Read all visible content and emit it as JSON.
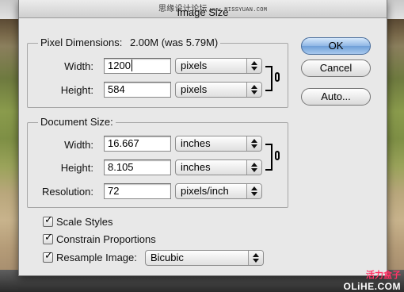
{
  "window": {
    "title": "Image Size",
    "watermark_top_cn": "思缘设计论坛",
    "watermark_top_url": "www.MISSYUAN.COM"
  },
  "pixel_dimensions": {
    "label": "Pixel Dimensions:",
    "summary": "2.00M (was 5.79M)",
    "width_label": "Width:",
    "width_value": "1200",
    "width_unit": "pixels",
    "height_label": "Height:",
    "height_value": "584",
    "height_unit": "pixels"
  },
  "document_size": {
    "label": "Document Size:",
    "width_label": "Width:",
    "width_value": "16.667",
    "width_unit": "inches",
    "height_label": "Height:",
    "height_value": "8.105",
    "height_unit": "inches",
    "resolution_label": "Resolution:",
    "resolution_value": "72",
    "resolution_unit": "pixels/inch"
  },
  "options": {
    "scale_styles": {
      "label": "Scale Styles",
      "checked": true
    },
    "constrain_proportions": {
      "label": "Constrain Proportions",
      "checked": true
    },
    "resample_image": {
      "label": "Resample Image:",
      "checked": true,
      "method": "Bicubic"
    }
  },
  "buttons": {
    "ok": "OK",
    "cancel": "Cancel",
    "auto": "Auto..."
  },
  "watermark_bottom": {
    "cn": "活力盒子",
    "en": "OLiHE.COM"
  },
  "colors": {
    "default_button": "#8fb7e5",
    "dialog_bg": "#e8e8e8",
    "watermark_cn": "#ff3366"
  }
}
